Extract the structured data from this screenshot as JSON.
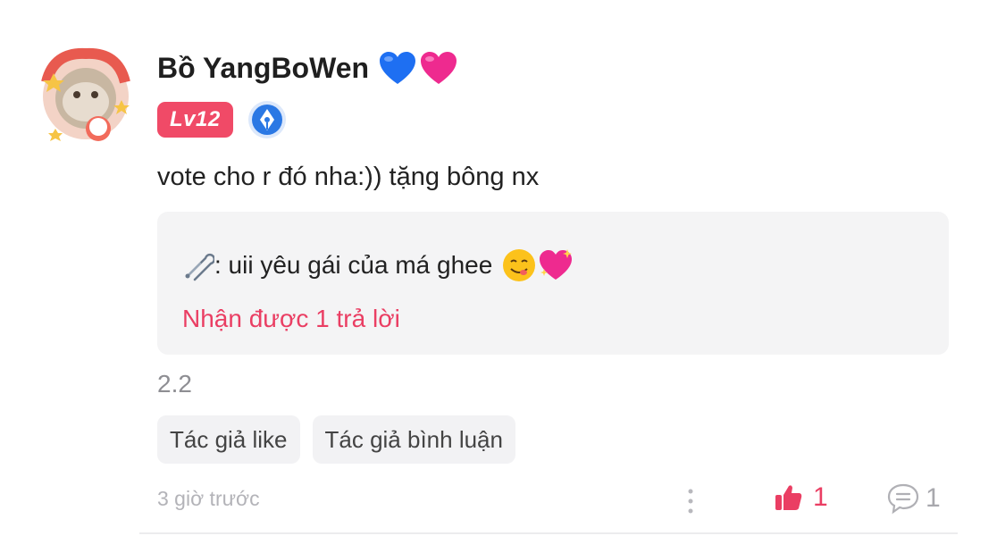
{
  "comment": {
    "username": "Bồ YangBoWen",
    "name_emojis": [
      "blue-heart-icon",
      "pink-heart-icon"
    ],
    "level_badge": "Lv12",
    "achievement_badge": "pen-nib-badge-icon",
    "text": "vote cho r đó nha:)) tặng bông nx",
    "reply_preview": {
      "prefix_icon": "safety-pin-icon",
      "text": ": uii yêu gái của má ghee",
      "emojis": [
        "yum-face-icon",
        "sparkling-heart-icon"
      ],
      "reply_count_text": "Nhận được 1 trả lời"
    },
    "version": "2.2",
    "tags": [
      "Tác giả like",
      "Tác giả bình luận"
    ],
    "timestamp": "3 giờ trước",
    "likes": "1",
    "replies": "1"
  },
  "colors": {
    "accent": "#ea3e63",
    "level_badge": "#f04a67",
    "reply_box_bg": "#f4f4f5",
    "muted_text": "#8e8e93"
  }
}
